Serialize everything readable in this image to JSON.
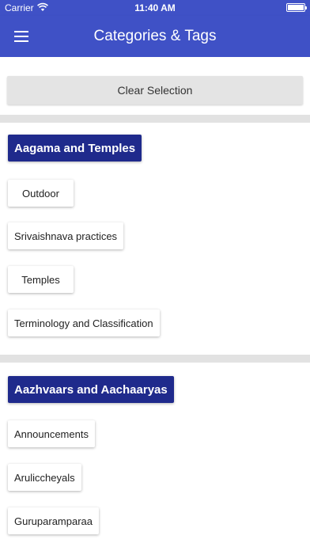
{
  "status_bar": {
    "carrier": "Carrier",
    "time": "11:40 AM"
  },
  "header": {
    "title": "Categories & Tags",
    "menu_icon": "hamburger-icon"
  },
  "actions": {
    "clear_label": "Clear Selection"
  },
  "colors": {
    "app_bar": "#3f51c6",
    "category": "#1f2a8c",
    "clear_button": "#e4e4e4",
    "divider": "#e2e2e2"
  },
  "sections": [
    {
      "title": "Aagama and Temples",
      "tags": [
        "Outdoor",
        "Srivaishnava practices",
        "Temples",
        "Terminology and Classification"
      ]
    },
    {
      "title": "Aazhvaars and Aachaaryas",
      "tags": [
        "Announcements",
        "Aruliccheyals",
        "Guruparamparaa"
      ]
    }
  ]
}
